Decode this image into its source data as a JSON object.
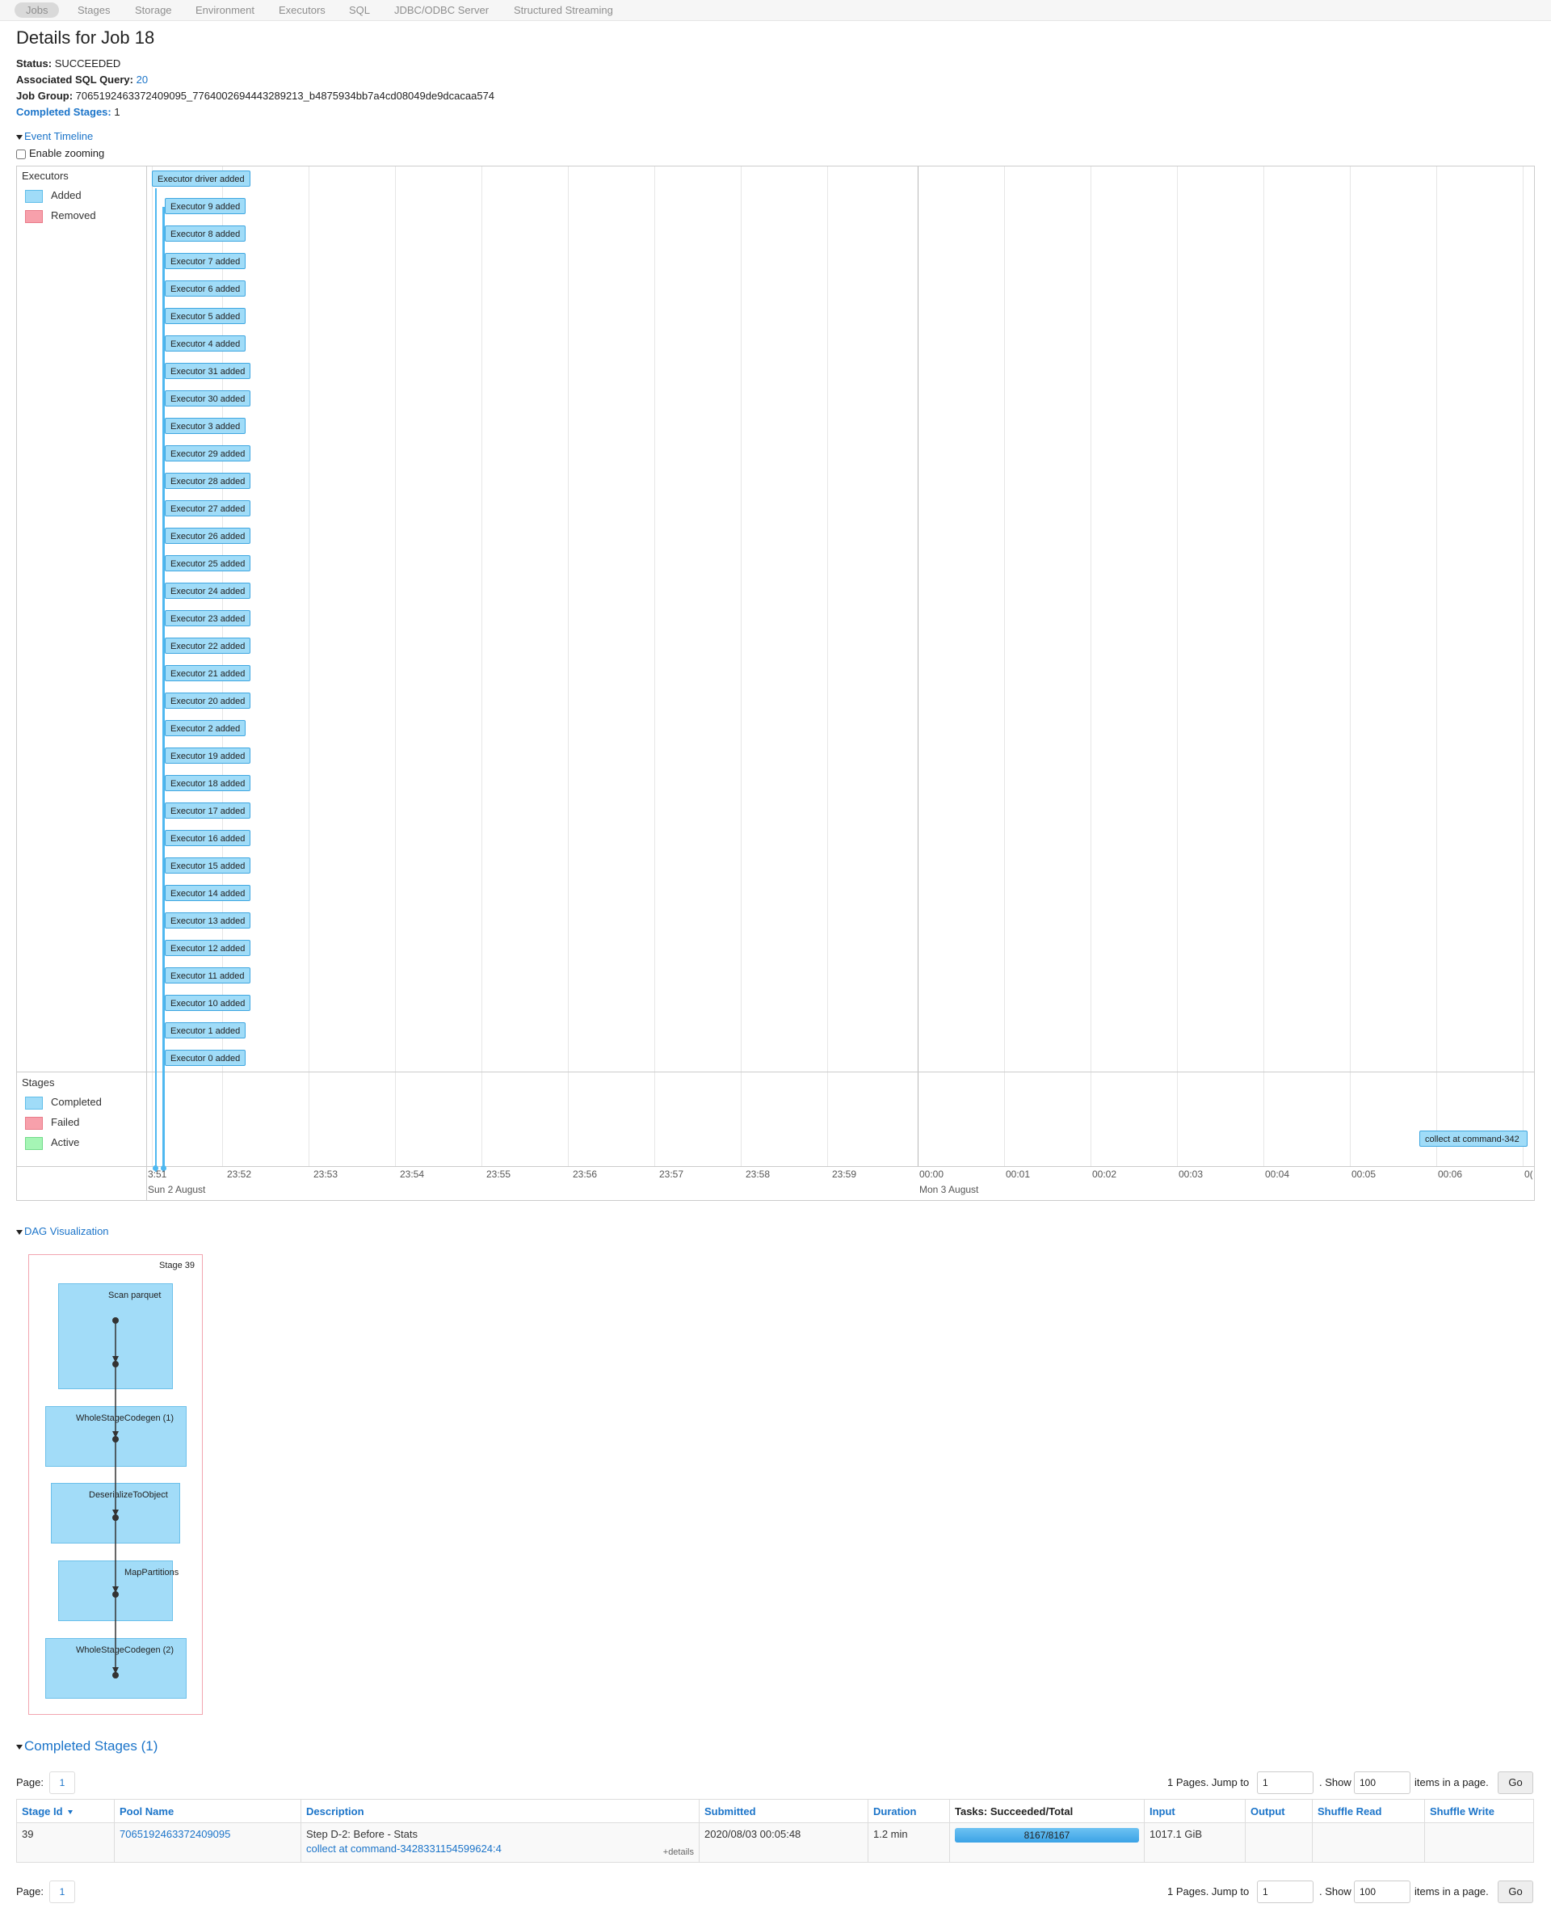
{
  "nav": {
    "tabs": [
      "Jobs",
      "Stages",
      "Storage",
      "Environment",
      "Executors",
      "SQL",
      "JDBC/ODBC Server",
      "Structured Streaming"
    ]
  },
  "page_title": "Details for Job 18",
  "summary": {
    "status_label": "Status:",
    "status_value": "SUCCEEDED",
    "sql_label": "Associated SQL Query:",
    "sql_value": "20",
    "group_label": "Job Group:",
    "group_value": "7065192463372409095_7764002694443289213_b4875934bb7a4cd08049de9dcacaa574",
    "completed_label": "Completed Stages:",
    "completed_value": "1"
  },
  "event_timeline": {
    "toggle_label": "Event Timeline",
    "zoom_label": "Enable zooming",
    "zoom_checked": false,
    "executors_legend": {
      "title": "Executors",
      "added": "Added",
      "removed": "Removed"
    },
    "stages_legend": {
      "title": "Stages",
      "completed": "Completed",
      "failed": "Failed",
      "active": "Active"
    },
    "colors": {
      "added": "#a0dcf8",
      "removed": "#f7a0ab",
      "active": "#a5f5b5",
      "accent": "#1b74c9"
    },
    "driver_event": "Executor driver added",
    "executor_events": [
      "Executor 9 added",
      "Executor 8 added",
      "Executor 7 added",
      "Executor 6 added",
      "Executor 5 added",
      "Executor 4 added",
      "Executor 31 added",
      "Executor 30 added",
      "Executor 3 added",
      "Executor 29 added",
      "Executor 28 added",
      "Executor 27 added",
      "Executor 26 added",
      "Executor 25 added",
      "Executor 24 added",
      "Executor 23 added",
      "Executor 22 added",
      "Executor 21 added",
      "Executor 20 added",
      "Executor 2 added",
      "Executor 19 added",
      "Executor 18 added",
      "Executor 17 added",
      "Executor 16 added",
      "Executor 15 added",
      "Executor 14 added",
      "Executor 13 added",
      "Executor 12 added",
      "Executor 11 added",
      "Executor 10 added",
      "Executor 1 added",
      "Executor 0 added"
    ],
    "stage_event": "collect at command-342",
    "ticks": [
      "3:51",
      "23:52",
      "23:53",
      "23:54",
      "23:55",
      "23:56",
      "23:57",
      "23:58",
      "23:59",
      "00:00",
      "00:01",
      "00:02",
      "00:03",
      "00:04",
      "00:05",
      "00:06",
      "0("
    ],
    "date_labels": [
      "Sun 2 August",
      "Mon 3 August"
    ]
  },
  "dag": {
    "toggle_label": "DAG Visualization",
    "stage_label": "Stage 39",
    "nodes": [
      "Scan parquet",
      "WholeStageCodegen (1)",
      "DeserializeToObject",
      "MapPartitions",
      "WholeStageCodegen (2)"
    ]
  },
  "completed_stages": {
    "toggle_label": "Completed Stages (1)",
    "pager": {
      "page_label": "Page:",
      "current_page": "1",
      "pages_text": "1 Pages. Jump to",
      "jump_value": "1",
      "show_label": ". Show",
      "show_value": "100",
      "items_text": "items in a page.",
      "go_label": "Go"
    },
    "columns": [
      "Stage Id",
      "Pool Name",
      "Description",
      "Submitted",
      "Duration",
      "Tasks: Succeeded/Total",
      "Input",
      "Output",
      "Shuffle Read",
      "Shuffle Write"
    ],
    "rows": [
      {
        "stage_id": "39",
        "pool_name": "7065192463372409095",
        "description": "Step D-2: Before - Stats",
        "description_link": "collect at command-3428331154599624:4",
        "details_link": "+details",
        "submitted": "2020/08/03 00:05:48",
        "duration": "1.2 min",
        "tasks_text": "8167/8167",
        "tasks_fraction": 1.0,
        "input": "1017.1 GiB",
        "output": "",
        "shuffle_read": "",
        "shuffle_write": ""
      }
    ]
  }
}
